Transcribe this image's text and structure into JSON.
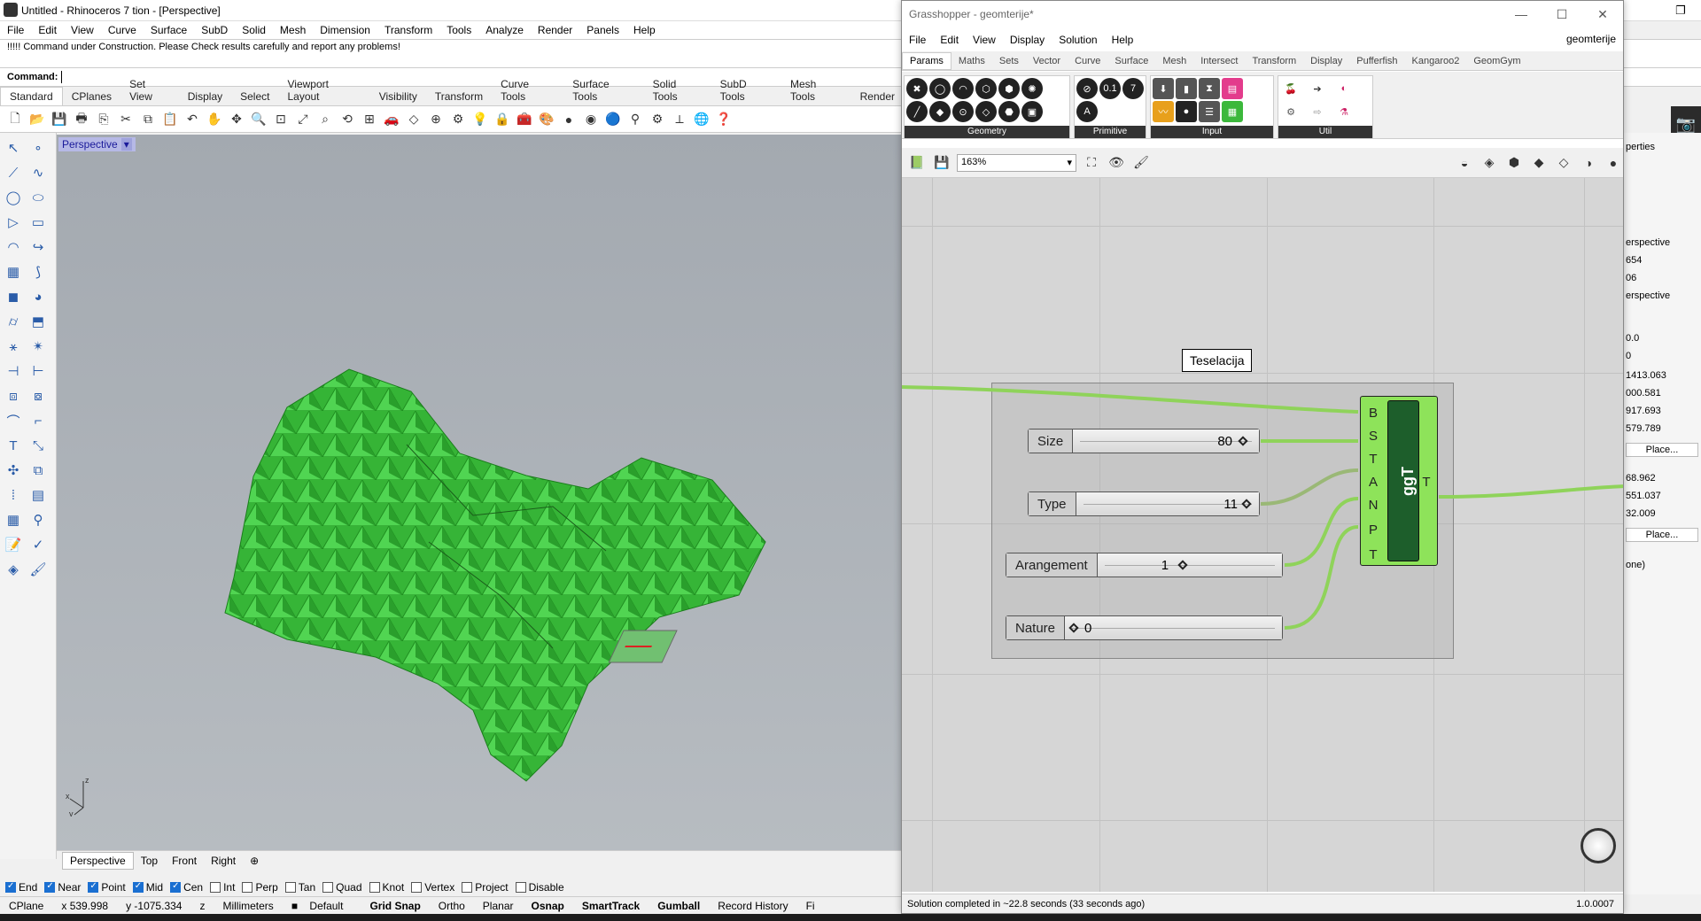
{
  "rhino": {
    "title": "Untitled - Rhinoceros 7 tion - [Perspective]",
    "menu": [
      "File",
      "Edit",
      "View",
      "Curve",
      "Surface",
      "SubD",
      "Solid",
      "Mesh",
      "Dimension",
      "Transform",
      "Tools",
      "Analyze",
      "Render",
      "Panels",
      "Help"
    ],
    "command_history": "!!!!! Command under Construction.  Please Check results carefully and report any problems!",
    "command_label": "Command:",
    "toolbar_tabs": [
      "Standard",
      "CPlanes",
      "Set View",
      "Display",
      "Select",
      "Viewport Layout",
      "Visibility",
      "Transform",
      "Curve Tools",
      "Surface Tools",
      "Solid Tools",
      "SubD Tools",
      "Mesh Tools",
      "Render"
    ],
    "viewport_label": "Perspective",
    "viewport_tabs": [
      "Perspective",
      "Top",
      "Front",
      "Right"
    ],
    "axis": {
      "x": "x",
      "y": "y",
      "z": "z"
    },
    "osnaps": [
      {
        "label": "End",
        "on": true
      },
      {
        "label": "Near",
        "on": true
      },
      {
        "label": "Point",
        "on": true
      },
      {
        "label": "Mid",
        "on": true
      },
      {
        "label": "Cen",
        "on": true
      },
      {
        "label": "Int",
        "on": false
      },
      {
        "label": "Perp",
        "on": false
      },
      {
        "label": "Tan",
        "on": false
      },
      {
        "label": "Quad",
        "on": false
      },
      {
        "label": "Knot",
        "on": false
      },
      {
        "label": "Vertex",
        "on": false
      },
      {
        "label": "Project",
        "on": false
      },
      {
        "label": "Disable",
        "on": false
      }
    ],
    "status": {
      "cplane": "CPlane",
      "x": "x 539.998",
      "y": "y -1075.334",
      "z": "z",
      "units": "Millimeters",
      "layer": "Default",
      "grid_snap": "Grid Snap",
      "ortho": "Ortho",
      "planar": "Planar",
      "osnap": "Osnap",
      "smarttrack": "SmartTrack",
      "gumball": "Gumball",
      "record_history": "Record History",
      "filter": "Fi"
    },
    "right_panel": [
      "perties",
      "erspective",
      "654",
      "06",
      "erspective",
      "0.0",
      "0",
      "1413.063",
      "000.581",
      "917.693",
      "579.789",
      "Place...",
      "68.962",
      "551.037",
      "32.009",
      "Place...",
      "one)"
    ]
  },
  "gh": {
    "title": "Grasshopper - geomterije*",
    "menu": [
      "File",
      "Edit",
      "View",
      "Display",
      "Solution",
      "Help"
    ],
    "docname": "geomterije",
    "tabs": [
      "Params",
      "Maths",
      "Sets",
      "Vector",
      "Curve",
      "Surface",
      "Mesh",
      "Intersect",
      "Transform",
      "Display",
      "Pufferfish",
      "Kangaroo2",
      "GeomGym"
    ],
    "groups": [
      "Geometry",
      "Primitive",
      "Input",
      "Util"
    ],
    "zoom": "163%",
    "group_label": "Teselacija",
    "sliders": [
      {
        "name": "Size",
        "value": "80"
      },
      {
        "name": "Type",
        "value": "11"
      },
      {
        "name": "Arangement",
        "value": "1"
      },
      {
        "name": "Nature",
        "value": "0"
      }
    ],
    "component": {
      "name": "ggT",
      "inputs": [
        "B",
        "S",
        "T",
        "A",
        "N",
        "P",
        "T"
      ],
      "output": "T"
    },
    "status": "Solution completed in ~22.8 seconds (33 seconds ago)",
    "version": "1.0.0007"
  },
  "colors": {
    "mesh_green": "#22b422",
    "wire_green": "#8fd35a",
    "component_green": "#8ee35a"
  }
}
